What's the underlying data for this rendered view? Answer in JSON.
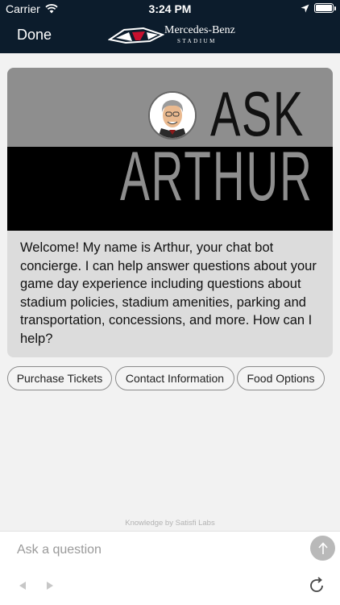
{
  "status_bar": {
    "carrier": "Carrier",
    "time": "3:24 PM",
    "icons": [
      "wifi-icon",
      "location-arrow-icon",
      "battery-icon"
    ],
    "battery_level": 1.0
  },
  "nav": {
    "done_label": "Done",
    "logo_name": "Mercedes-Benz",
    "logo_sub": "STADIUM"
  },
  "chat": {
    "banner": {
      "ask": "ASK",
      "name": "ARTHUR"
    },
    "welcome_message": "Welcome! My name is Arthur, your chat bot concierge. I can help answer questions about your game day experience including questions about stadium policies, stadium amenities, parking and transportation, concessions, and more. How can I help?",
    "quick_replies": [
      {
        "label": "Purchase Tickets"
      },
      {
        "label": "Contact Information"
      },
      {
        "label": "Food Options"
      }
    ],
    "powered_by": "Knowledge by Satisfi Labs"
  },
  "input": {
    "placeholder": "Ask a question",
    "value": ""
  },
  "colors": {
    "header_bg": "#0c1c2c",
    "banner_gray": "#8e8e8e",
    "banner_black": "#000000",
    "card_bg": "#dcdcdc",
    "send_button": "#b9b9b9"
  }
}
